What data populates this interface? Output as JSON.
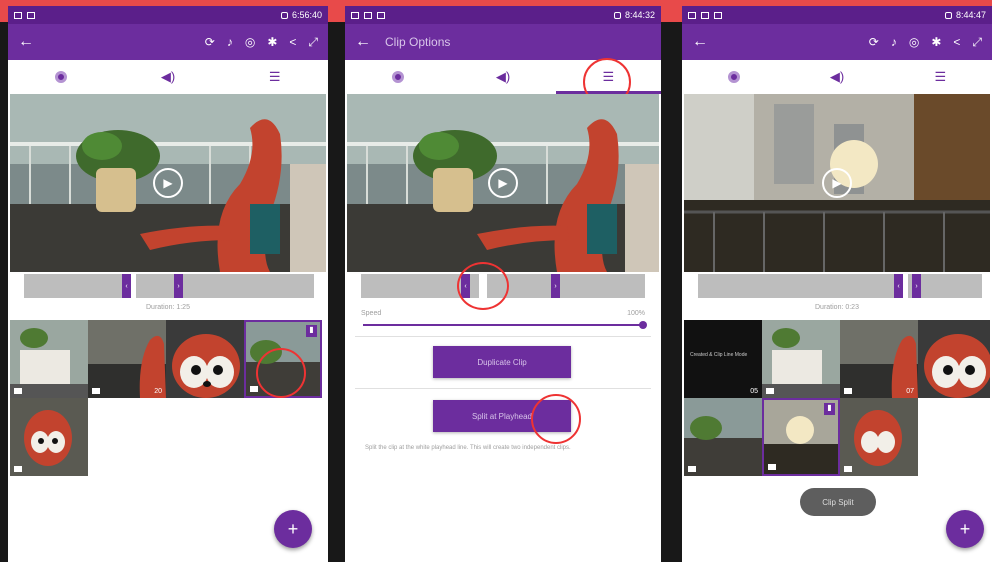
{
  "colors": {
    "accent": "#6c2d9e",
    "status_bar": "#5b1f8a",
    "highlight": "#e33333",
    "banner": "#e84a4a"
  },
  "panel1": {
    "status_time": "6:56:40",
    "actions": [
      "sync-icon",
      "music-icon",
      "layers-icon",
      "gear-icon",
      "share-icon",
      "fullscreen-icon"
    ],
    "tabs": [
      "settings-tab",
      "audio-tab",
      "clip-options-tab"
    ],
    "duration": "Duration: 1:25",
    "thumbs": [
      {
        "num": ""
      },
      {
        "num": "20"
      },
      {
        "num": ""
      },
      {
        "num": ""
      },
      {
        "num": ""
      }
    ],
    "fab": "+"
  },
  "panel2": {
    "status_time": "8:44:32",
    "title": "Clip Options",
    "speed_label": "Speed",
    "speed_value": "100%",
    "speed_fraction": 1.0,
    "duplicate_label": "Duplicate Clip",
    "split_label": "Split at Playhead",
    "description": "Split the clip at the white playhead line. This will create two independent clips."
  },
  "panel3": {
    "status_time": "8:44:47",
    "duration": "Duration: 0:23",
    "thumbs": [
      {
        "num": "05",
        "text": "Created & Clip Line Mode"
      },
      {
        "num": ""
      },
      {
        "num": "07"
      },
      {
        "num": ""
      },
      {
        "num": ""
      },
      {
        "num": ""
      },
      {
        "num": ""
      }
    ],
    "toast": "Clip Split",
    "fab": "+"
  }
}
